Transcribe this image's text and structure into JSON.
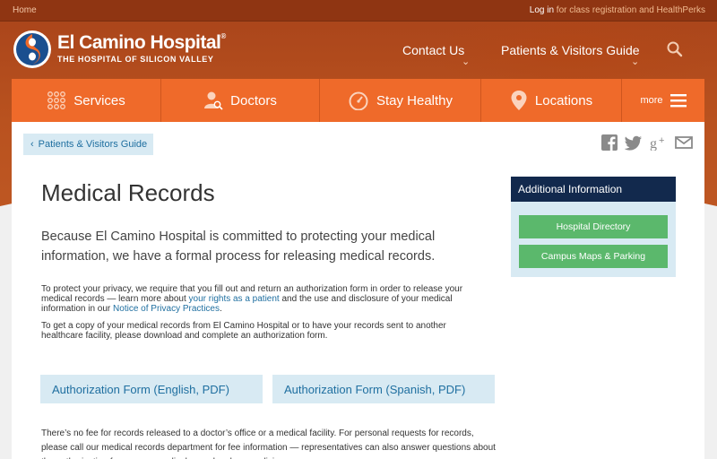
{
  "topbar": {
    "home": "Home",
    "login": "Log in",
    "login_suffix": " for class registration and HealthPerks"
  },
  "brand": {
    "name": "El Camino Hospital",
    "registered": "®",
    "tagline": "THE HOSPITAL OF SILICON VALLEY"
  },
  "header_nav": [
    {
      "label": "Contact Us",
      "icon": "chevron-down-icon"
    },
    {
      "label": "Patients & Visitors Guide",
      "icon": "chevron-down-icon"
    }
  ],
  "main_nav": [
    {
      "label": "Services",
      "icon": "grid-dots-icon"
    },
    {
      "label": "Doctors",
      "icon": "doctor-search-icon"
    },
    {
      "label": "Stay Healthy",
      "icon": "gauge-icon"
    },
    {
      "label": "Locations",
      "icon": "map-pin-icon"
    },
    {
      "label": "more",
      "icon": "hamburger-icon"
    }
  ],
  "breadcrumb": {
    "back": "Patients & Visitors Guide"
  },
  "share_icons": [
    "facebook-icon",
    "twitter-icon",
    "google-plus-icon",
    "email-icon"
  ],
  "page": {
    "title": "Medical Records",
    "lead": "Because El Camino Hospital is committed to protecting your medical information, we have a formal process for releasing medical records.",
    "p1_a": "To protect your privacy, we require that you fill out and return an authorization form in order to release your medical records — learn more about ",
    "p1_link1": "your rights as a patient",
    "p1_b": " and the use and disclosure of your medical information in our ",
    "p1_link2": "Notice of Privacy Practices",
    "p1_c": ".",
    "p2": "To get a copy of your medical records from El Camino Hospital or to have your records sent to another healthcare facility, please download and complete an authorization form.",
    "form_en": "Authorization Form (English, PDF)",
    "form_es": "Authorization Form (Spanish, PDF)",
    "fee": "There’s no fee for records released to a doctor’s office or a medical facility. For personal requests for records, please call our medical records department for fee information — representatives can also answer questions about the authorization form or our medical records release policies:"
  },
  "sidebar": {
    "heading": "Additional Information",
    "buttons": [
      "Hospital Directory",
      "Campus Maps & Parking"
    ]
  },
  "colors": {
    "accent": "#ef6a2a",
    "navy": "#12294d",
    "link": "#1f6fa0",
    "green": "#5bb86c",
    "light_blue": "#d8eaf3"
  }
}
